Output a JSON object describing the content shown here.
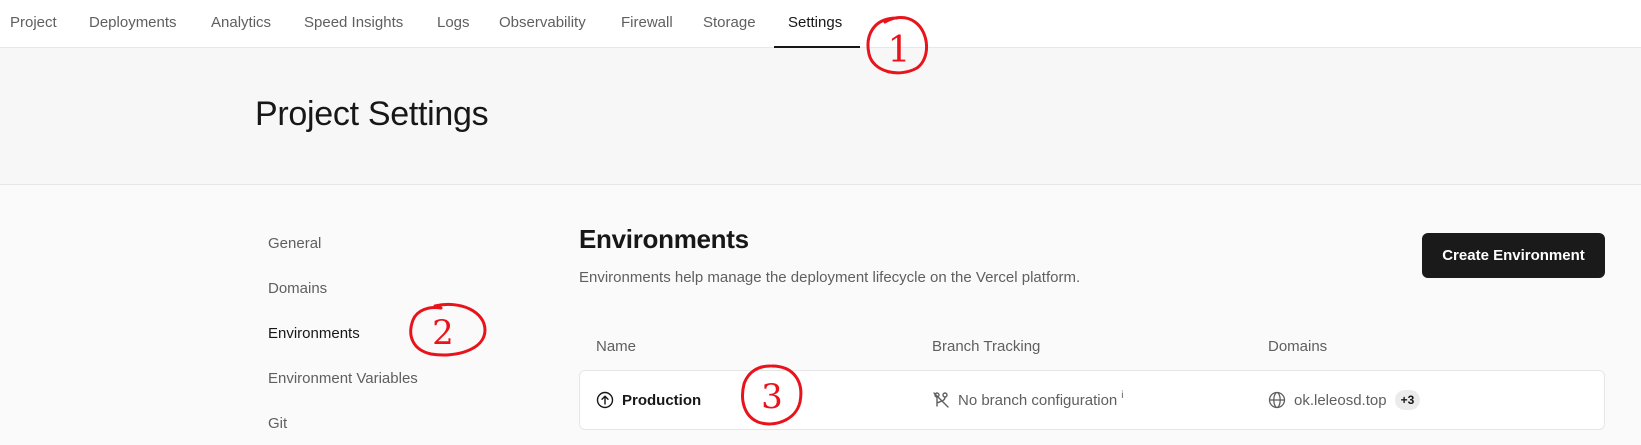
{
  "topnav": {
    "tabs": [
      {
        "label": "Project"
      },
      {
        "label": "Deployments"
      },
      {
        "label": "Analytics"
      },
      {
        "label": "Speed Insights"
      },
      {
        "label": "Logs"
      },
      {
        "label": "Observability"
      },
      {
        "label": "Firewall"
      },
      {
        "label": "Storage"
      },
      {
        "label": "Settings",
        "active": true
      }
    ]
  },
  "header": {
    "title": "Project Settings"
  },
  "sidebar": {
    "items": [
      {
        "label": "General"
      },
      {
        "label": "Domains"
      },
      {
        "label": "Environments",
        "active": true
      },
      {
        "label": "Environment Variables"
      },
      {
        "label": "Git"
      }
    ]
  },
  "main": {
    "title": "Environments",
    "description": "Environments help manage the deployment lifecycle on the Vercel platform.",
    "create_button": "Create Environment",
    "table": {
      "columns": [
        "Name",
        "Branch Tracking",
        "Domains"
      ],
      "rows": [
        {
          "name": "Production",
          "name_icon": "arrow-up-circle-icon",
          "branch": "No branch configuration",
          "branch_icon": "branch-off-icon",
          "info_icon": "i",
          "domain": "ok.leleosd.top",
          "domain_icon": "globe-icon",
          "extra_domains": "+3"
        }
      ]
    }
  },
  "annotations": {
    "color": "#e8131b",
    "marks": [
      "1",
      "2",
      "3"
    ]
  }
}
